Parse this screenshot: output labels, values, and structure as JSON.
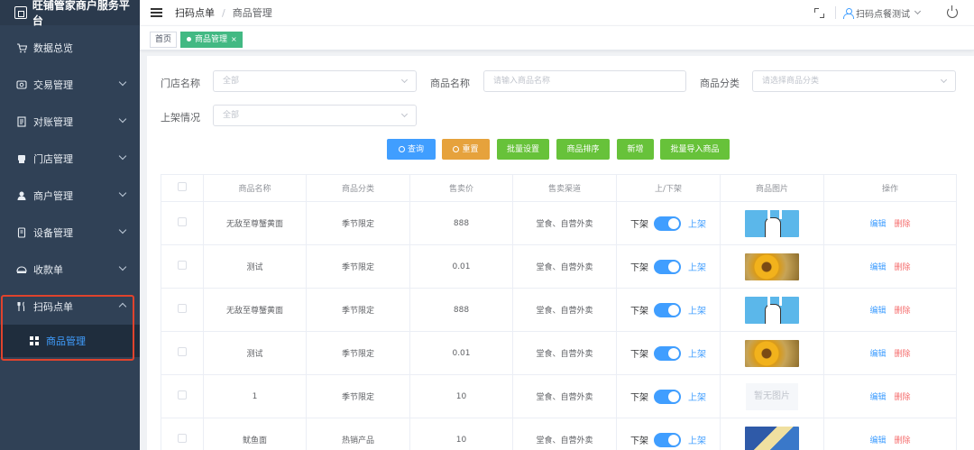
{
  "sidebar": {
    "brand": "旺铺管家商户服务平台",
    "items": [
      {
        "label": "数据总览",
        "icon": "cart-icon"
      },
      {
        "label": "交易管理",
        "icon": "transaction-icon"
      },
      {
        "label": "对账管理",
        "icon": "reconcile-icon"
      },
      {
        "label": "门店管理",
        "icon": "store-icon"
      },
      {
        "label": "商户管理",
        "icon": "user-icon"
      },
      {
        "label": "设备管理",
        "icon": "device-icon"
      },
      {
        "label": "收款单",
        "icon": "receipt-icon"
      },
      {
        "label": "扫码点单",
        "icon": "fork-knife-icon"
      }
    ],
    "subitem": {
      "label": "商品管理",
      "icon": "grid-icon"
    }
  },
  "header": {
    "breadcrumb": [
      "扫码点单",
      "商品管理"
    ],
    "user": "扫码点餐测试"
  },
  "tags": {
    "home": "首页",
    "active": "商品管理",
    "close": "×"
  },
  "filters": {
    "store_label": "门店名称",
    "store_value": "全部",
    "product_label": "商品名称",
    "product_placeholder": "请输入商品名称",
    "category_label": "商品分类",
    "category_placeholder": "请选择商品分类",
    "status_label": "上架情况",
    "status_value": "全部"
  },
  "buttons": {
    "query": "查询",
    "reset": "重置",
    "batch_set": "批量设置",
    "sort": "商品排序",
    "add": "新增",
    "batch_import": "批量导入商品"
  },
  "table": {
    "headers": [
      "商品名称",
      "商品分类",
      "售卖价",
      "售卖渠道",
      "上/下架",
      "商品图片",
      "操作"
    ],
    "toggle_off": "下架",
    "toggle_on": "上架",
    "edit": "编辑",
    "delete": "删除",
    "no_image": "暂无图片",
    "rows": [
      {
        "name": "无敌至尊蟹黄面",
        "category": "季节限定",
        "price": "888",
        "channel": "堂食、自营外卖",
        "image": "rabbit"
      },
      {
        "name": "测试",
        "category": "季节限定",
        "price": "0.01",
        "channel": "堂食、自营外卖",
        "image": "flower"
      },
      {
        "name": "无敌至尊蟹黄面",
        "category": "季节限定",
        "price": "888",
        "channel": "堂食、自营外卖",
        "image": "rabbit"
      },
      {
        "name": "测试",
        "category": "季节限定",
        "price": "0.01",
        "channel": "堂食、自营外卖",
        "image": "flower"
      },
      {
        "name": "1",
        "category": "季节限定",
        "price": "10",
        "channel": "堂食、自营外卖",
        "image": "none"
      },
      {
        "name": "鱿鱼面",
        "category": "热销产品",
        "price": "10",
        "channel": "堂食、自营外卖",
        "image": "poster"
      }
    ]
  }
}
